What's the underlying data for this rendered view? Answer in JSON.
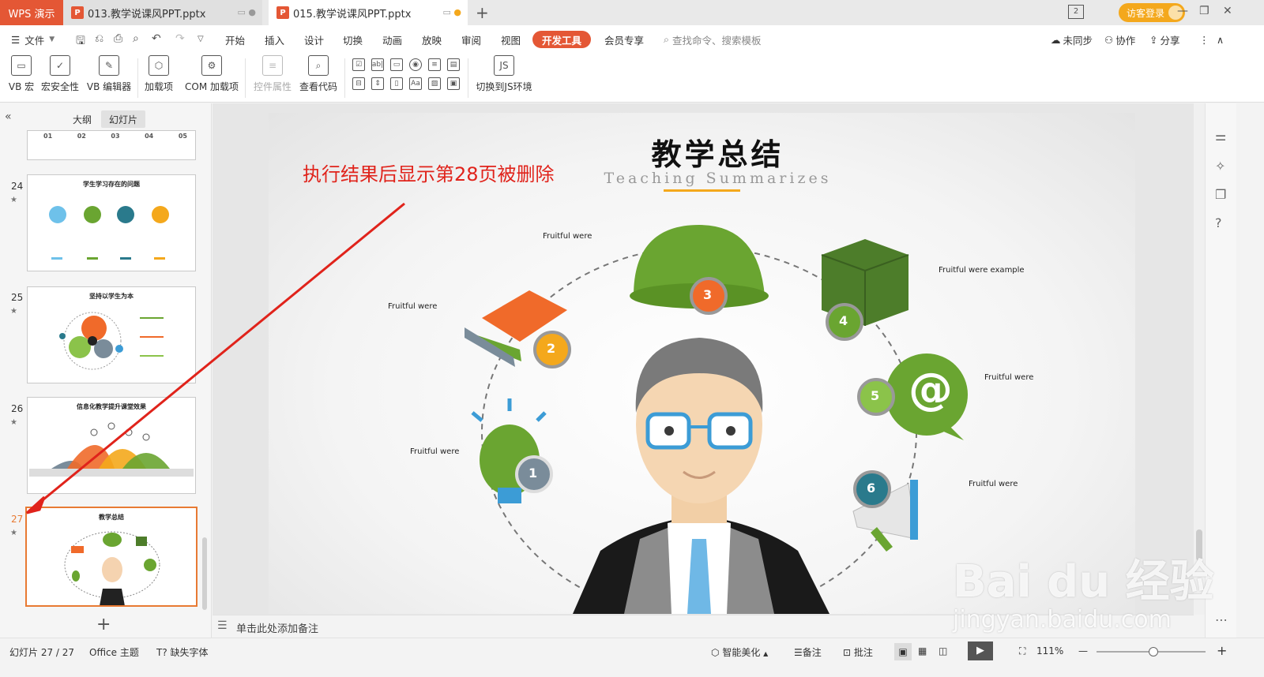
{
  "titlebar": {
    "app_name": "WPS 演示",
    "tabs": [
      {
        "label": "013.教学说课风PPT.pptx",
        "icon": "P"
      },
      {
        "label": "015.教学说课风PPT.pptx",
        "icon": "P"
      }
    ],
    "new_tab": "+",
    "window_count": "2",
    "login_label": "访客登录"
  },
  "menubar": {
    "file": "文件",
    "items": [
      "开始",
      "插入",
      "设计",
      "切换",
      "动画",
      "放映",
      "审阅",
      "视图",
      "开发工具",
      "会员专享"
    ],
    "active_item": "开发工具",
    "search_placeholder": "查找命令、搜索模板",
    "sync": "未同步",
    "collab": "协作",
    "share": "分享"
  },
  "ribbon": {
    "buttons": [
      "VB 宏",
      "宏安全性",
      "VB 编辑器",
      "加载项",
      "COM 加载项",
      "控件属性",
      "查看代码",
      "切换到JS环境"
    ],
    "small_icons": [
      "☑",
      "ab|",
      "▭",
      "◉",
      "≡",
      "▤",
      "⊟",
      "⇕",
      "▯",
      "Aa",
      "▨",
      "▣"
    ]
  },
  "leftpanel": {
    "tabs": [
      "大纲",
      "幻灯片"
    ],
    "active_tab": "幻灯片",
    "collapse_icon": "«",
    "add_icon": "+",
    "slides": [
      {
        "num": "24",
        "title": "学生学习存在的问题"
      },
      {
        "num": "25",
        "title": "坚持以学生为本"
      },
      {
        "num": "26",
        "title": "信息化教学提升课堂效果"
      },
      {
        "num": "27",
        "title": "教学总结"
      }
    ],
    "partial_labels": [
      "01",
      "02",
      "03",
      "04",
      "05"
    ],
    "star": "★"
  },
  "slide": {
    "title": "教学总结",
    "subtitle": "Teaching Summarizes",
    "annotation": "执行结果后显示第28页被删除",
    "labels": [
      "Fruitful were",
      "Fruitful were",
      "Fruitful were example",
      "Fruitful were",
      "Fruitful were",
      "Fruitful were"
    ],
    "badges": [
      "1",
      "2",
      "3",
      "4",
      "5",
      "6"
    ]
  },
  "notes": {
    "placeholder": "单击此处添加备注"
  },
  "statusbar": {
    "slide_counter": "幻灯片 27 / 27",
    "theme": "Office 主题",
    "missing_font": "缺失字体",
    "beautify": "智能美化",
    "notes": "备注",
    "comments": "批注",
    "zoom": "111%"
  },
  "watermark": {
    "brand": "Bai du 经验",
    "url": "jingyan.baidu.com"
  },
  "colors": {
    "accent": "#e45735",
    "annotation_red": "#e0231b",
    "selected_orange": "#e87a33",
    "green": "#6aa531",
    "orange": "#f4a81c",
    "teal": "#2a7a8c"
  }
}
